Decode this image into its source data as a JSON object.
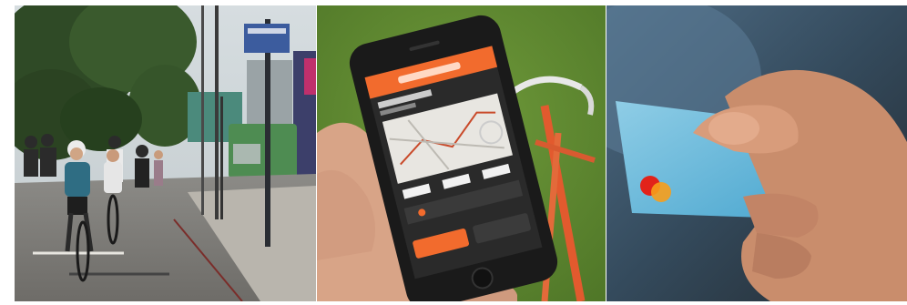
{
  "panels": [
    {
      "subject": "cyclists-on-city-street"
    },
    {
      "subject": "hand-holding-phone-cycling-app"
    },
    {
      "subject": "hand-holding-payment-card"
    }
  ]
}
